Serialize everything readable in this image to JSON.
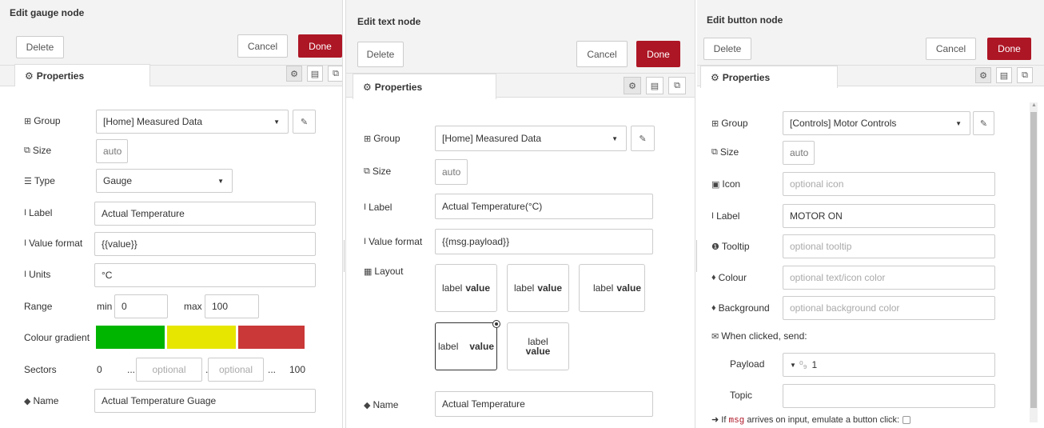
{
  "gauge": {
    "title": "Edit gauge node",
    "delete": "Delete",
    "cancel": "Cancel",
    "done": "Done",
    "tab": "Properties",
    "group_label": "Group",
    "group_value": "[Home] Measured Data",
    "size_label": "Size",
    "size_value": "auto",
    "type_label": "Type",
    "type_value": "Gauge",
    "label_label": "Label",
    "label_value": "Actual Temperature",
    "format_label": "Value format",
    "format_value": "{{value}}",
    "units_label": "Units",
    "units_value": "°C",
    "range_label": "Range",
    "min_label": "min",
    "min_value": "0",
    "max_label": "max",
    "max_value": "100",
    "gradient_label": "Colour gradient",
    "gradient_colors": [
      "#00b500",
      "#e6e600",
      "#ca3838"
    ],
    "sectors_label": "Sectors",
    "sector_start": "0",
    "sector_dots1": "...",
    "sector_ph1": "optional",
    "sector_dots2": "...",
    "sector_ph2": "optional",
    "sector_dots3": "...",
    "sector_end": "100",
    "name_label": "Name",
    "name_value": "Actual Temperature Guage"
  },
  "text": {
    "title": "Edit text node",
    "delete": "Delete",
    "cancel": "Cancel",
    "done": "Done",
    "tab": "Properties",
    "group_label": "Group",
    "group_value": "[Home] Measured Data",
    "size_label": "Size",
    "size_value": "auto",
    "label_label": "Label",
    "label_value": "Actual Temperature(°C)",
    "format_label": "Value format",
    "format_value": "{{msg.payload}}",
    "layout_label": "Layout",
    "layout_opt_label": "label",
    "layout_opt_value": "value",
    "name_label": "Name",
    "name_value": "Actual Temperature"
  },
  "button": {
    "title": "Edit button node",
    "delete": "Delete",
    "cancel": "Cancel",
    "done": "Done",
    "tab": "Properties",
    "group_label": "Group",
    "group_value": "[Controls] Motor Controls",
    "size_label": "Size",
    "size_value": "auto",
    "icon_label": "Icon",
    "icon_ph": "optional icon",
    "label_label": "Label",
    "label_value": "MOTOR ON",
    "tooltip_label": "Tooltip",
    "tooltip_ph": "optional tooltip",
    "colour_label": "Colour",
    "colour_ph": "optional text/icon color",
    "background_label": "Background",
    "background_ph": "optional background color",
    "when_clicked": "When clicked, send:",
    "payload_label": "Payload",
    "payload_type": "⁰₉",
    "payload_value": "1",
    "topic_label": "Topic",
    "footer_pre": "If",
    "footer_code": "msg",
    "footer_post": "arrives on input, emulate a button click:"
  },
  "colors": {
    "done": "#ad1625"
  }
}
